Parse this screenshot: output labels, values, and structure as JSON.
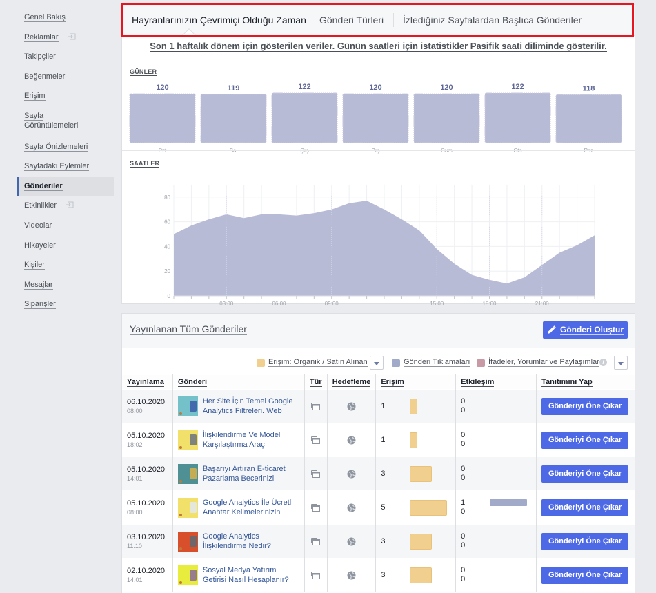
{
  "sidebar": {
    "items": [
      {
        "label": "Genel Bakış",
        "external": false,
        "active": false
      },
      {
        "label": "Reklamlar",
        "external": true,
        "active": false
      },
      {
        "label": "Takipçiler",
        "external": false,
        "active": false
      },
      {
        "label": "Beğenmeler",
        "external": false,
        "active": false
      },
      {
        "label": "Erişim",
        "external": false,
        "active": false
      },
      {
        "label": "Sayfa Görüntülemeleri",
        "external": false,
        "active": false
      },
      {
        "label": "Sayfa Önizlemeleri",
        "external": false,
        "active": false
      },
      {
        "label": "Sayfadaki Eylemler",
        "external": false,
        "active": false
      },
      {
        "label": "Gönderiler",
        "external": false,
        "active": true
      },
      {
        "label": "Etkinlikler",
        "external": true,
        "active": false
      },
      {
        "label": "Videolar",
        "external": false,
        "active": false
      },
      {
        "label": "Hikayeler",
        "external": false,
        "active": false
      },
      {
        "label": "Kişiler",
        "external": false,
        "active": false
      },
      {
        "label": "Mesajlar",
        "external": false,
        "active": false
      },
      {
        "label": "Siparişler",
        "external": false,
        "active": false
      }
    ]
  },
  "tabs": [
    {
      "label": "Hayranlarınızın Çevrimiçi Olduğu Zaman",
      "active": true
    },
    {
      "label": "Gönderi Türleri",
      "active": false
    },
    {
      "label": "İzlediğiniz Sayfalardan Başlıca Gönderiler",
      "active": false
    }
  ],
  "info_line": "Son 1 haftalık dönem için gösterilen veriler. Günün saatleri için istatistikler Pasifik saati diliminde gösterilir.",
  "colors": {
    "chart_fill": "#b8bbd6",
    "value_label": "#5e6798",
    "primary_button": "#4e69e6",
    "reach_bar": "#f1cf8f",
    "clicks_legend": "#a1aac9",
    "reactions_legend": "#c79aa6",
    "highlight_border": "#e8141f"
  },
  "chart_data": [
    {
      "type": "bar",
      "title": "GÜNLER",
      "categories": [
        "Pzt",
        "Sal",
        "Çrş",
        "Prş",
        "Cum",
        "Cts",
        "Paz"
      ],
      "values": [
        120,
        119,
        122,
        120,
        120,
        122,
        118
      ],
      "data_labels": true,
      "xlabel": "",
      "ylabel": ""
    },
    {
      "type": "area",
      "title": "SAATLER",
      "x": [
        0,
        1,
        2,
        3,
        4,
        5,
        6,
        7,
        8,
        9,
        10,
        11,
        12,
        13,
        14,
        15,
        16,
        17,
        18,
        19,
        20,
        21,
        22,
        23,
        24
      ],
      "values": [
        50,
        57,
        62,
        66,
        63,
        66,
        66,
        65,
        67,
        70,
        75,
        77,
        70,
        62,
        53,
        38,
        26,
        17,
        13,
        10,
        15,
        25,
        35,
        41,
        49
      ],
      "xticks": [
        "03:00",
        "06:00",
        "09:00",
        "15:00",
        "18:00",
        "21:00"
      ],
      "xtick_hours": [
        3,
        6,
        9,
        15,
        18,
        21
      ],
      "yticks": [
        0,
        20,
        40,
        60,
        80
      ],
      "ylim": [
        0,
        90
      ],
      "grid": true,
      "xlabel": "",
      "ylabel": ""
    }
  ],
  "posts_section": {
    "title": "Yayınlanan Tüm Gönderiler",
    "create_button": "Gönderi Oluştur",
    "legend": {
      "reach": "Erişim: Organik / Satın Alınan",
      "clicks": "Gönderi Tıklamaları",
      "reactions": "İfadeler, Yorumlar ve Paylaşımlar",
      "info_icon": "i"
    },
    "columns": [
      "Yayınlama",
      "Gönderi",
      "Tür",
      "Hedefleme",
      "Erişim",
      "Etkileşim",
      "Tanıtımını Yap"
    ],
    "rows": [
      {
        "date": "06.10.2020",
        "time": "08:00",
        "title": "Her Site İçin Temel Google Analytics Filtreleri. Web",
        "thumb_color": "#74c1c9",
        "fig_color": "#3b5aa8",
        "reach": 1,
        "clicks": 0,
        "reactions": 0,
        "boost": "Gönderiyi Öne Çıkar"
      },
      {
        "date": "05.10.2020",
        "time": "18:02",
        "title": "İlişkilendirme Ve Model Karşılaştırma Araç",
        "thumb_color": "#f1e06a",
        "fig_color": "#6b7280",
        "reach": 1,
        "clicks": 0,
        "reactions": 0,
        "boost": "Gönderiyi Öne Çıkar"
      },
      {
        "date": "05.10.2020",
        "time": "14:01",
        "title": "Başarıyı Artıran E-ticaret Pazarlama Becerinizi",
        "thumb_color": "#4f9095",
        "fig_color": "#d8b14a",
        "reach": 3,
        "clicks": 0,
        "reactions": 0,
        "boost": "Gönderiyi Öne Çıkar"
      },
      {
        "date": "05.10.2020",
        "time": "08:00",
        "title": "Google Analytics İle Ücretli Anahtar Kelimelerinizin",
        "thumb_color": "#f1e06a",
        "fig_color": "#e4e8ee",
        "reach": 5,
        "clicks": 1,
        "reactions": 0,
        "boost": "Gönderiyi Öne Çıkar"
      },
      {
        "date": "03.10.2020",
        "time": "11:10",
        "title": "Google Analytics İlişkilendirme Nedir?",
        "thumb_color": "#d84f2c",
        "fig_color": "#5d6a75",
        "reach": 3,
        "clicks": 0,
        "reactions": 0,
        "boost": "Gönderiyi Öne Çıkar"
      },
      {
        "date": "02.10.2020",
        "time": "14:01",
        "title": "Sosyal Medya Yatırım Getirisi Nasıl Hesaplanır?",
        "thumb_color": "#e8ec3c",
        "fig_color": "#8a6a9a",
        "reach": 3,
        "clicks": 0,
        "reactions": 0,
        "boost": "Gönderiyi Öne Çıkar"
      }
    ]
  }
}
